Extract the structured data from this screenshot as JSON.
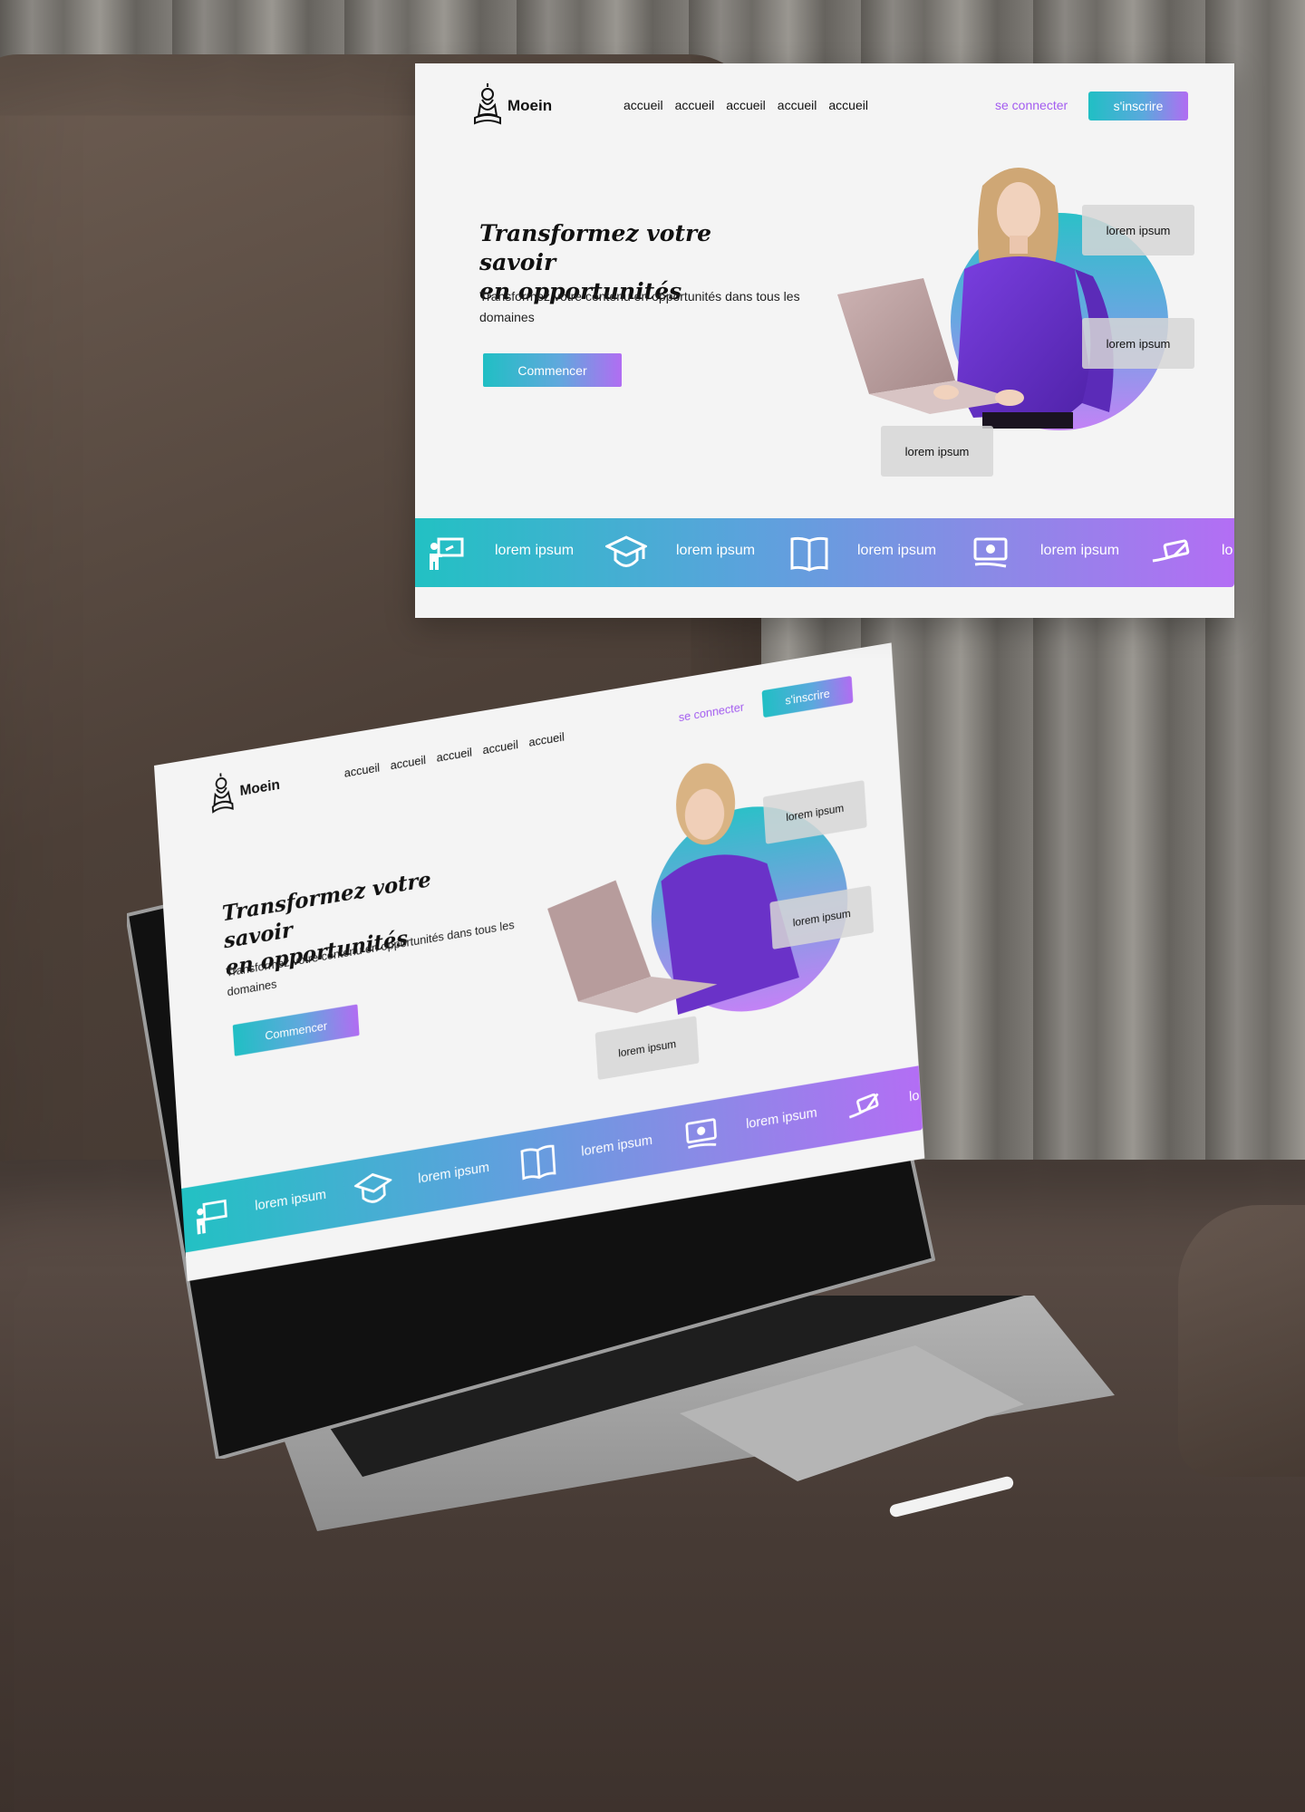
{
  "brand": {
    "name": "Moein"
  },
  "nav": {
    "links": [
      "accueil",
      "accueil",
      "accueil",
      "accueil",
      "accueil"
    ],
    "login_label": "se connecter",
    "signup_label": "s'inscrire"
  },
  "hero": {
    "title_line1": "Transformez votre savoir",
    "title_line2": "en opportunités",
    "description": "Transformez votre contenu en opportunités dans tous les domaines",
    "cta_label": "Commencer",
    "cards": [
      "lorem ipsum",
      "lorem ipsum",
      "lorem ipsum"
    ]
  },
  "band": {
    "items": [
      {
        "icon": "teacher-board-icon",
        "label": "lorem ipsum"
      },
      {
        "icon": "graduation-cap-icon",
        "label": "lorem ipsum"
      },
      {
        "icon": "open-book-icon",
        "label": "lorem ipsum"
      },
      {
        "icon": "money-hand-icon",
        "label": "lorem ipsum"
      },
      {
        "icon": "hand-card-icon",
        "label": "lo"
      }
    ]
  },
  "colors": {
    "gradient_start": "#20bfc4",
    "gradient_end": "#b16df2",
    "accent_link": "#a35cf0",
    "shirt": "#6a32c8",
    "page_bg": "#f4f4f4"
  }
}
